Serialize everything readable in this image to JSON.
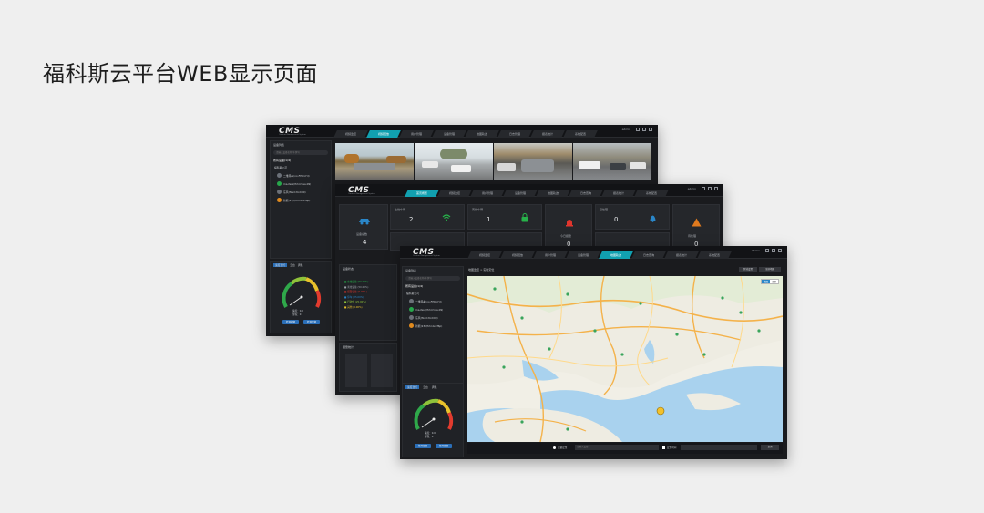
{
  "page": {
    "title": "福科斯云平台WEB显示页面"
  },
  "app": {
    "logo": "CMS",
    "logo_sub": "Content Management System",
    "user": "admin"
  },
  "tabs_back": [
    {
      "label": "视频监控",
      "active": false
    },
    {
      "label": "视频回放",
      "active": true
    },
    {
      "label": "用户管理",
      "active": false
    },
    {
      "label": "设备管理",
      "active": false
    },
    {
      "label": "地图轨迹",
      "active": false
    },
    {
      "label": "日志管理",
      "active": false
    },
    {
      "label": "报表统计",
      "active": false
    },
    {
      "label": "系统配置",
      "active": false
    }
  ],
  "tabs_mid": [
    {
      "label": "首页概览",
      "active": true
    },
    {
      "label": "视频监控",
      "active": false
    },
    {
      "label": "用户管理",
      "active": false
    },
    {
      "label": "设备管理",
      "active": false
    },
    {
      "label": "地图轨迹",
      "active": false
    },
    {
      "label": "日志查询",
      "active": false
    },
    {
      "label": "报表统计",
      "active": false
    },
    {
      "label": "系统配置",
      "active": false
    }
  ],
  "tabs_front": [
    {
      "label": "视频监控",
      "active": false
    },
    {
      "label": "视频回放",
      "active": false
    },
    {
      "label": "用户管理",
      "active": false
    },
    {
      "label": "设备管理",
      "active": false
    },
    {
      "label": "地图轨迹",
      "active": true
    },
    {
      "label": "日志查询",
      "active": false
    },
    {
      "label": "报表统计",
      "active": false
    },
    {
      "label": "系统配置",
      "active": false
    }
  ],
  "device_panel": {
    "title": "设备列表",
    "search_placeholder": "请输入设备名称/车牌号",
    "group_label": "所有设备(1/4)",
    "company": "福科斯公司",
    "devices": [
      {
        "name": "二维码车(no.FHK17d)",
        "status": "offline"
      },
      {
        "name": "ma-fasx(fkhr.f.rea.09)",
        "status": "online"
      },
      {
        "name": "东风(fkad.f.bdr00)",
        "status": "offline"
      },
      {
        "name": "新能(23)(fkhr.bnkf6p)",
        "status": "alarm"
      }
    ]
  },
  "gauge": {
    "tabs": [
      "速度监控",
      "云台",
      "调色"
    ],
    "speed_text": "速度：0.0",
    "dir_text": "里程：0",
    "buttons": [
      "打开视频",
      "打开音频"
    ]
  },
  "overview": {
    "cards": [
      {
        "label": "在线车辆",
        "value": "2",
        "icon": "wifi-icon"
      },
      {
        "label": "离线车辆",
        "value": "1",
        "icon": "lock-icon"
      },
      {
        "label": "今日报警",
        "value": "0",
        "icon": "alarm-icon"
      },
      {
        "label": "已处理",
        "value": "0",
        "icon": "bell-icon"
      },
      {
        "label": "设备总数",
        "value": "4",
        "icon": "car-icon"
      },
      {
        "label": "待处理",
        "value": "0",
        "icon": "warning-icon"
      }
    ],
    "legend_title": "设备状态",
    "legend": [
      "■ 在线设备 (50.00%)",
      "■ 离线设备 (50.00%)",
      "■ 报警设备 (0.00%)",
      "■ 停车 (25.00%)",
      "■ 行驶中 (25.00%)",
      "■ 其他 (0.00%)"
    ],
    "alarm_title": "报警统计"
  },
  "map": {
    "breadcrumb": "地图监控 > 实时定位",
    "top_buttons": [
      "区域设置",
      "全屏地图"
    ],
    "type_buttons": [
      "地图",
      "卫星"
    ],
    "bottom_label": "设备定位",
    "bottom_search": "请输入设备",
    "bottom_label2": "定位时间",
    "bottom_btn": "查询"
  },
  "colors": {
    "accent": "#11a0b0",
    "online": "#27a64b",
    "alarm": "#e0352d",
    "warning": "#e07a1e",
    "bg": "#1a1b1e"
  }
}
